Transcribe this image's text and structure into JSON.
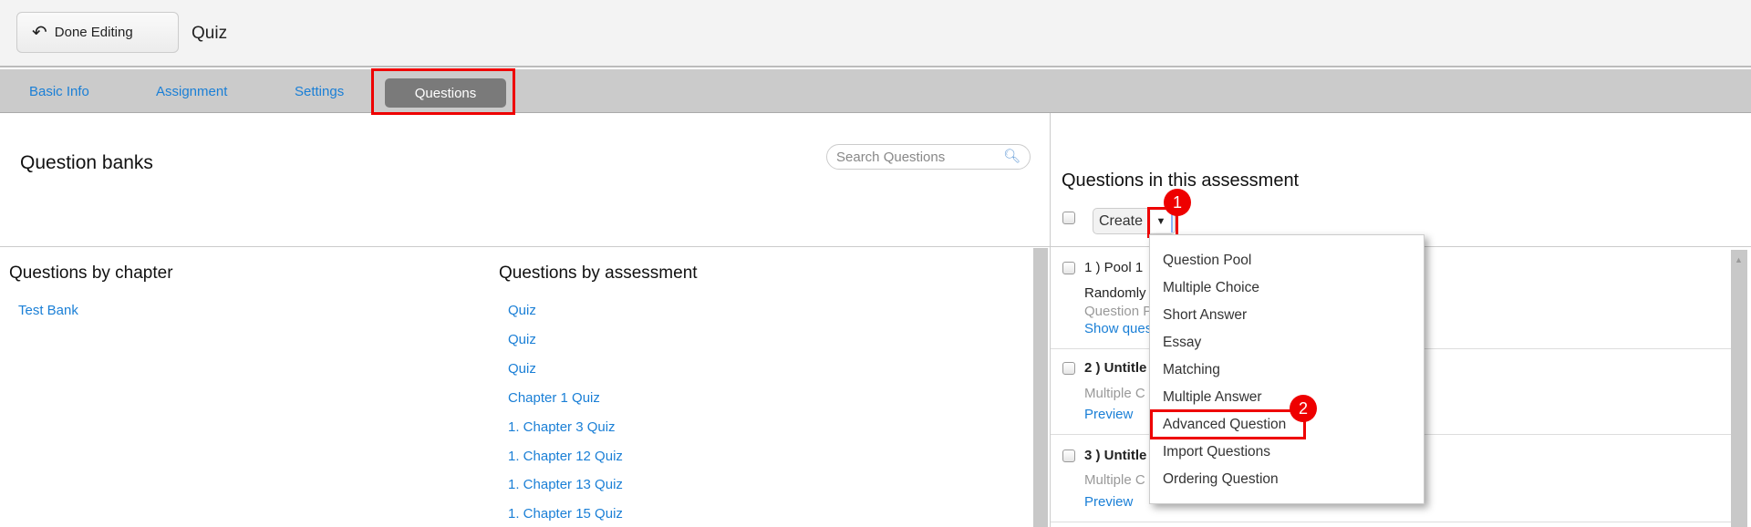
{
  "header": {
    "done_label": "Done Editing",
    "title": "Quiz"
  },
  "tabs": [
    {
      "label": "Basic Info"
    },
    {
      "label": "Assignment"
    },
    {
      "label": "Settings"
    },
    {
      "label": "Questions",
      "active": true
    }
  ],
  "left": {
    "title": "Question banks",
    "search_placeholder": "Search Questions",
    "by_chapter_title": "Questions by chapter",
    "chapters": [
      "Test Bank"
    ],
    "by_assessment_title": "Questions by assessment",
    "assessments": [
      "Quiz",
      "Quiz",
      "Quiz",
      "Chapter 1 Quiz",
      "1. Chapter 3 Quiz",
      "1. Chapter 12 Quiz",
      "1. Chapter 13 Quiz",
      "1. Chapter 15 Quiz"
    ]
  },
  "right": {
    "title": "Questions in this assessment",
    "create_label": "Create",
    "questions": [
      {
        "title": "1 ) Pool 1",
        "line1": "Randomly",
        "line2": "Question P",
        "link": "Show ques"
      },
      {
        "title": "2 ) Untitle",
        "line2": "Multiple C",
        "link": "Preview"
      },
      {
        "title": "3 ) Untitle",
        "line2": "Multiple C",
        "link": "Preview"
      }
    ]
  },
  "menu": {
    "items": [
      "Question Pool",
      "Multiple Choice",
      "Short Answer",
      "Essay",
      "Matching",
      "Multiple Answer",
      "Advanced Question",
      "Import Questions",
      "Ordering Question"
    ]
  },
  "annotations": {
    "badge1": "1",
    "badge2": "2",
    "color": "#ee0000"
  }
}
